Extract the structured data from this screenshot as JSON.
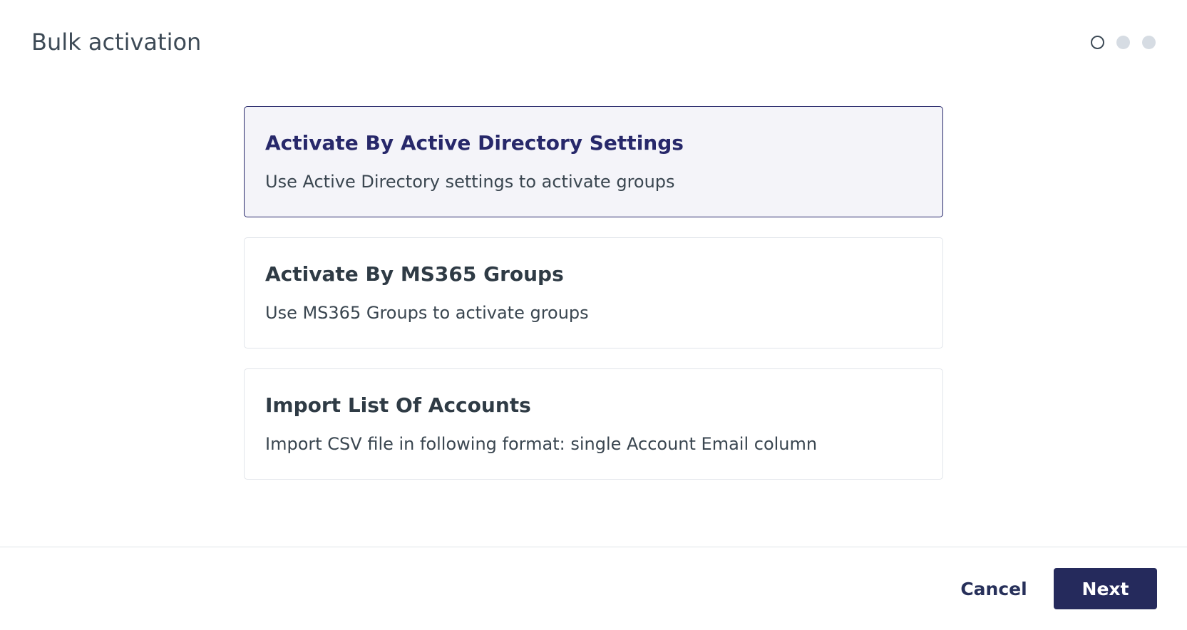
{
  "header": {
    "title": "Bulk activation",
    "steps": [
      {
        "state": "active"
      },
      {
        "state": "inactive"
      },
      {
        "state": "inactive"
      }
    ]
  },
  "options": [
    {
      "title": "Activate By Active Directory Settings",
      "description": "Use Active Directory settings to activate groups",
      "selected": true
    },
    {
      "title": "Activate By MS365 Groups",
      "description": "Use MS365 Groups to activate groups",
      "selected": false
    },
    {
      "title": "Import List Of Accounts",
      "description": "Import CSV file in following format: single Account Email column",
      "selected": false
    }
  ],
  "footer": {
    "cancel_label": "Cancel",
    "next_label": "Next"
  },
  "colors": {
    "accent": "#27286a",
    "primary_button": "#252a5c",
    "selected_bg": "#f4f4f9",
    "step_inactive": "#d6dce3"
  }
}
